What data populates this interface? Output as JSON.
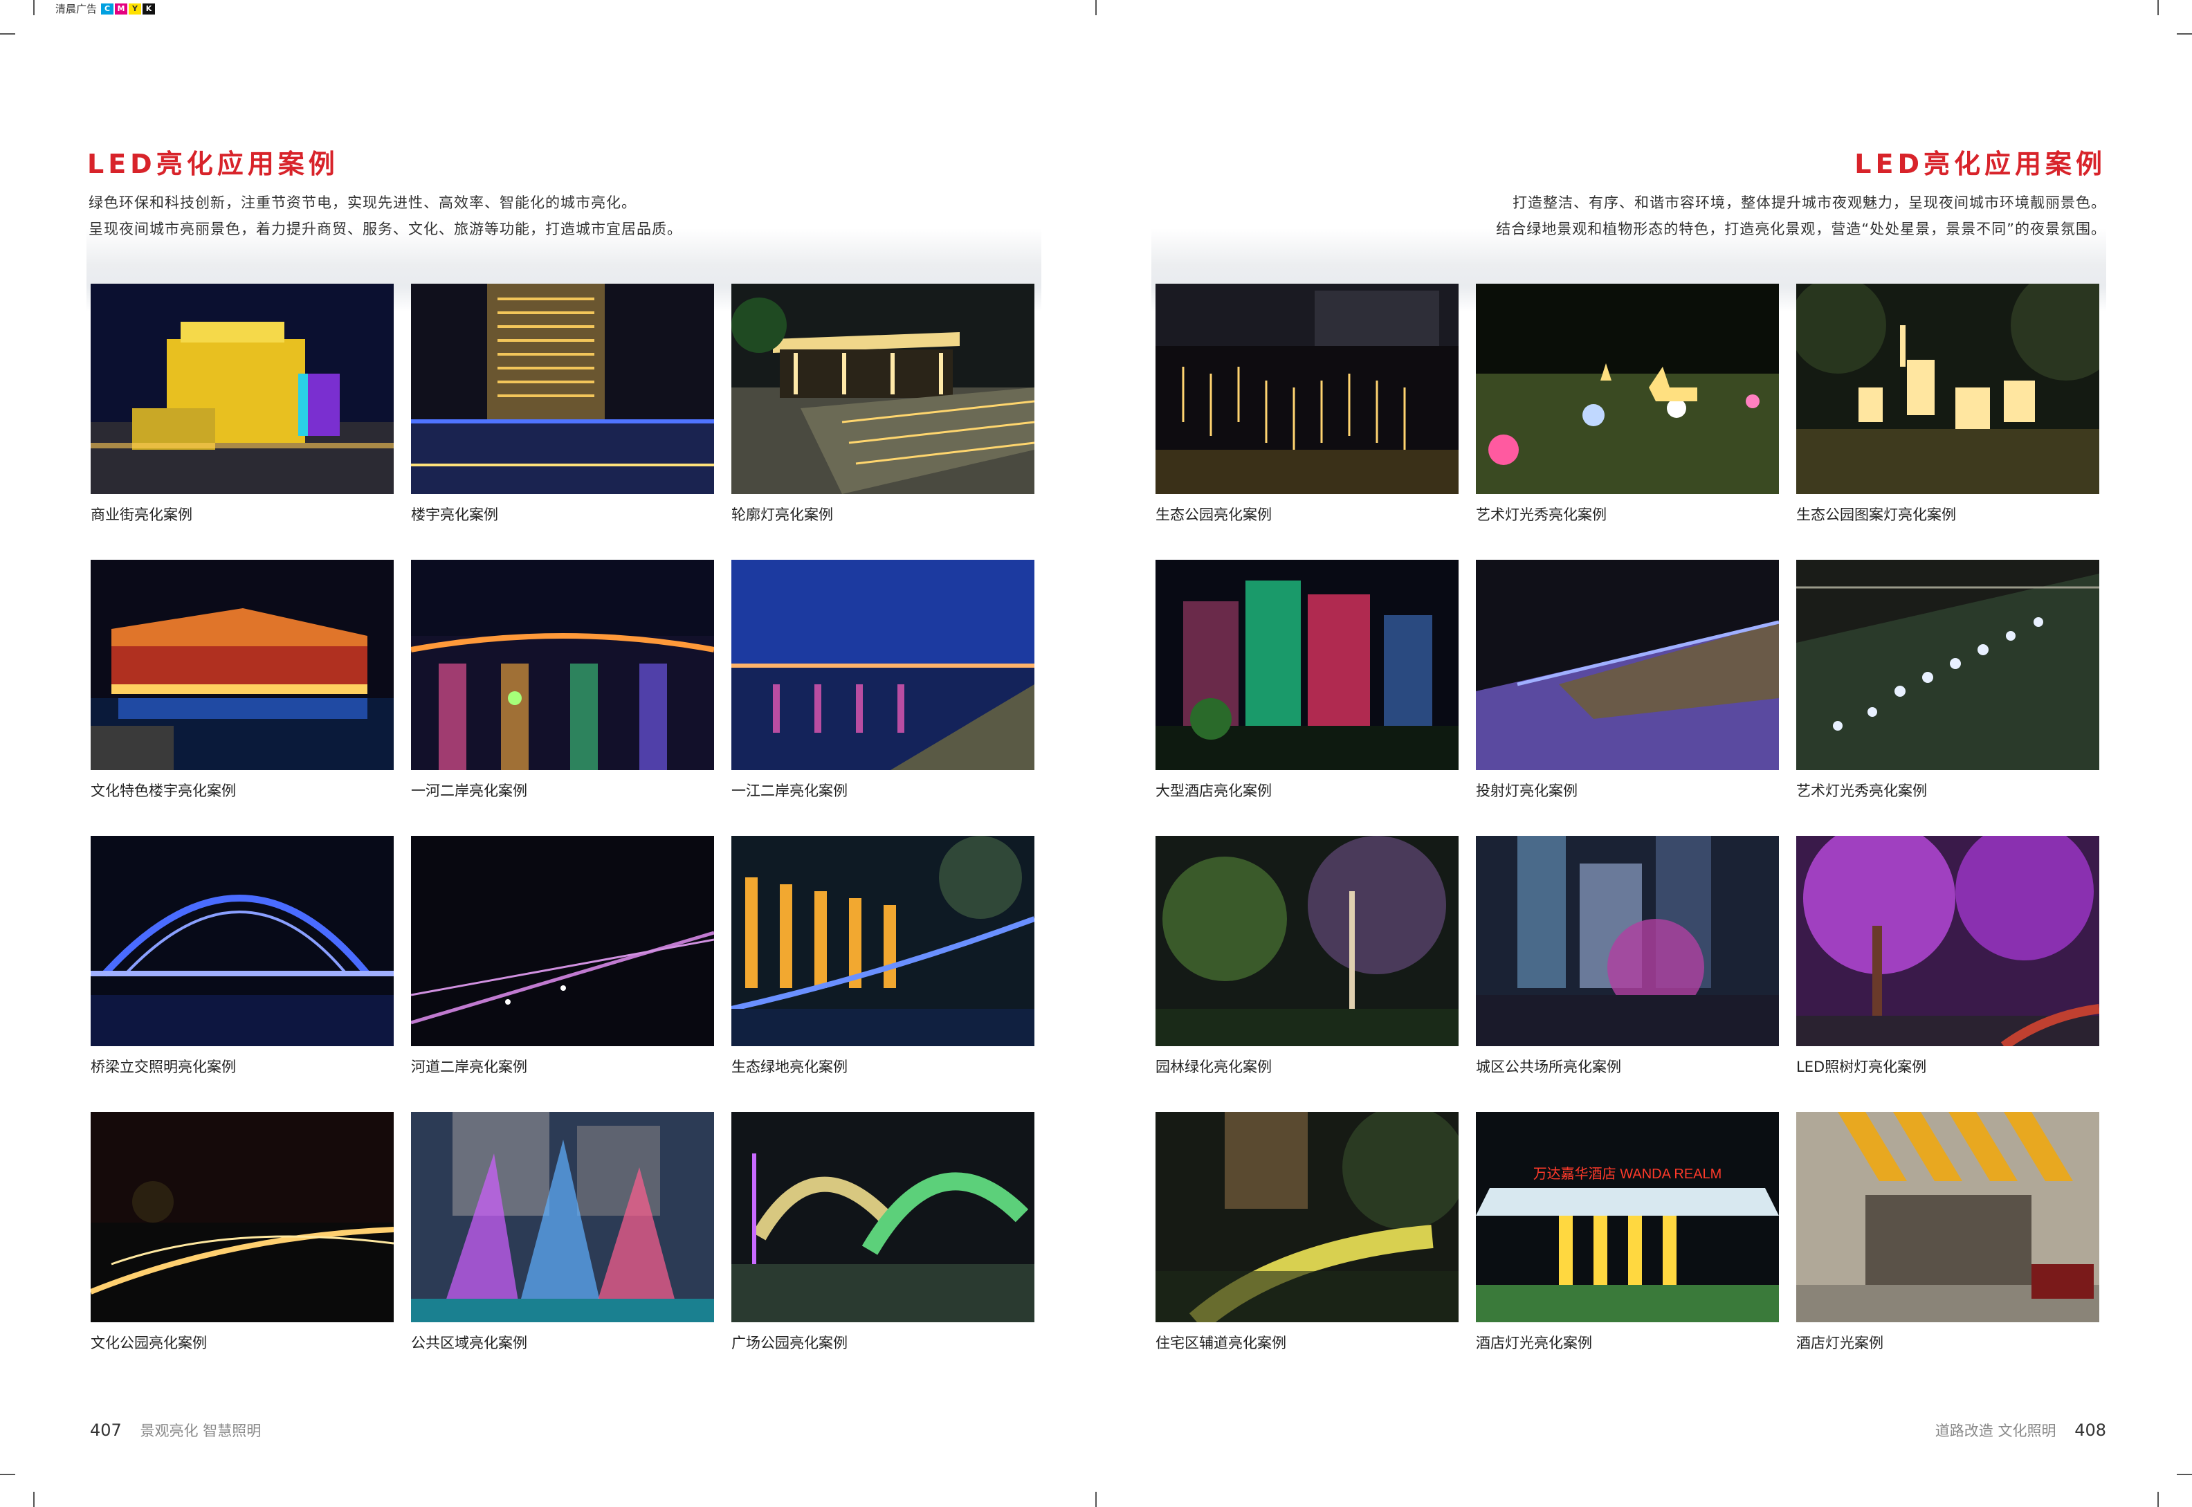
{
  "printer": {
    "name": "清晨广告",
    "cmyk": [
      "C",
      "M",
      "Y",
      "K"
    ]
  },
  "left_page": {
    "title": "LED亮化应用案例",
    "intro": [
      "绿色环保和科技创新，注重节资节电，实现先进性、高效率、智能化的城市亮化。",
      "呈现夜间城市亮丽景色，着力提升商贸、服务、文化、旅游等功能，打造城市宜居品质。"
    ],
    "captions": [
      "商业街亮化案例",
      "楼宇亮化案例",
      "轮廓灯亮化案例",
      "文化特色楼宇亮化案例",
      "一河二岸亮化案例",
      "一江二岸亮化案例",
      "桥梁立交照明亮化案例",
      "河道二岸亮化案例",
      "生态绿地亮化案例",
      "文化公园亮化案例",
      "公共区域亮化案例",
      "广场公园亮化案例"
    ],
    "footer": {
      "page_number": "407",
      "text": "景观亮化   智慧照明"
    }
  },
  "right_page": {
    "title": "LED亮化应用案例",
    "intro": [
      "打造整洁、有序、和谐市容环境，整体提升城市夜观魅力，呈现夜间城市环境靓丽景色。",
      "结合绿地景观和植物形态的特色，打造亮化景观，营造“处处星景，景景不同”的夜景氛围。"
    ],
    "captions": [
      "生态公园亮化案例",
      "艺术灯光秀亮化案例",
      "生态公园图案灯亮化案例",
      "大型酒店亮化案例",
      "投射灯亮化案例",
      "艺术灯光秀亮化案例",
      "园林绿化亮化案例",
      "城区公共场所亮化案例",
      "LED照树灯亮化案例",
      "住宅区辅道亮化案例",
      "酒店灯光亮化案例",
      "酒店灯光案例"
    ],
    "sign_text": "万达嘉华酒店 WANDA REALM",
    "footer": {
      "page_number": "408",
      "text": "道路改造   文化照明"
    }
  },
  "colors": {
    "title_red": "#d8232a"
  }
}
